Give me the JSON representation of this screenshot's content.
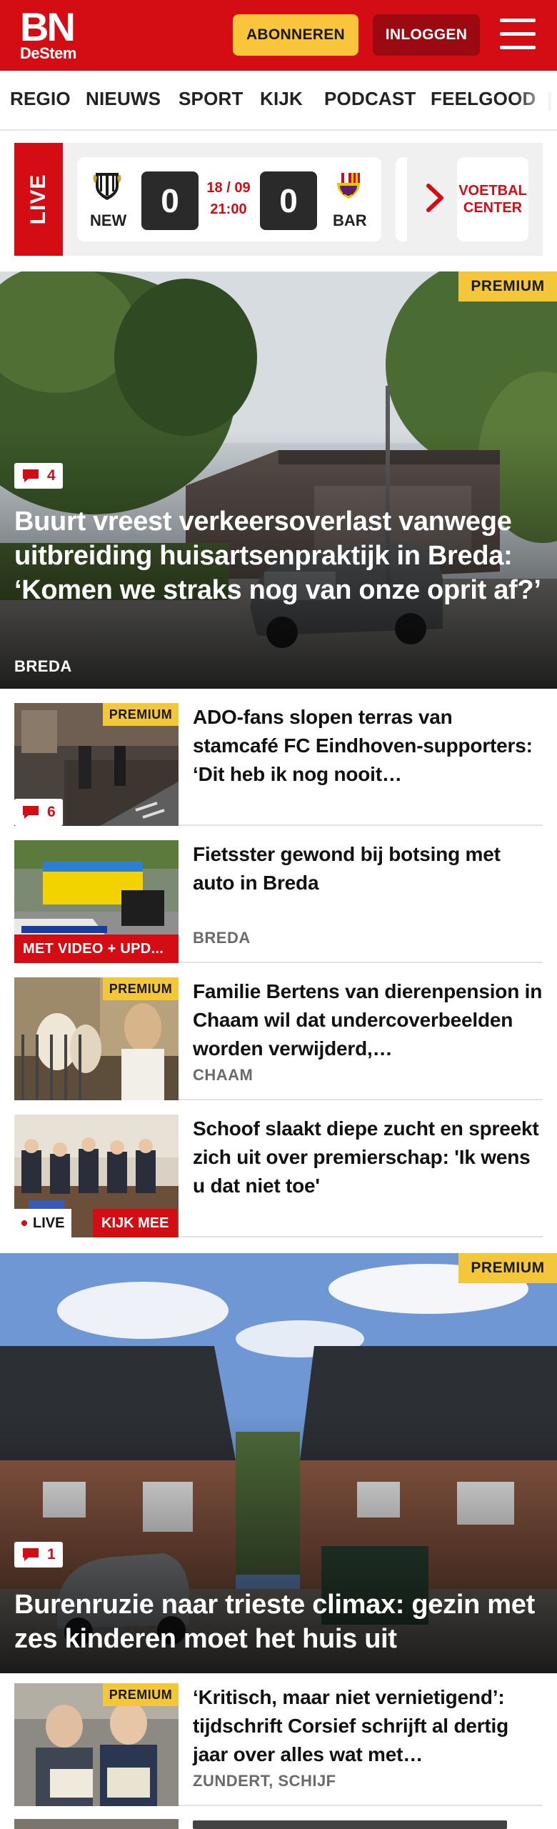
{
  "header": {
    "logo_main": "BN",
    "logo_sub": "DeStem",
    "subscribe_label": "ABONNEREN",
    "login_label": "INLOGGEN",
    "brand_color": "#d40d14"
  },
  "nav": {
    "items": [
      "REGIO",
      "NIEUWS",
      "SPORT",
      "KIJK",
      "PODCAST",
      "FEELGOOD"
    ]
  },
  "live_score": {
    "tab_label": "LIVE",
    "home_team": "NEW",
    "away_team": "BAR",
    "home_score": "0",
    "away_score": "0",
    "date": "18 / 09",
    "time": "21:00",
    "voetbal_center": "VOETBAL CENTER"
  },
  "hero1": {
    "premium": "PREMIUM",
    "comments": "4",
    "title": "Buurt vreest verkeersoverlast vanwege uitbreiding huisartsenprak­tijk in Breda: ‘Komen we straks nog van onze oprit af?’",
    "tag": "BREDA"
  },
  "articles": [
    {
      "premium": "PREMIUM",
      "comments": "6",
      "title": "ADO-fans slopen terras van stamcafé FC Eindhoven-supporters: ‘Dit heb ik nog nooit…"
    },
    {
      "badge": "MET VIDEO + UPD...",
      "title": "Fietsster gewond bij botsing met auto in Breda",
      "tag": "BREDA"
    },
    {
      "premium": "PREMIUM",
      "title": "Familie Bertens van dierenpensi­on in Chaam wil dat undercover­beelden worden verwijderd,…",
      "tag": "CHAAM"
    },
    {
      "live": "LIVE",
      "watch": "KIJK MEE",
      "title": "Schoof slaakt diepe zucht en spreekt zich uit over premier­schap: 'Ik wens u dat niet toe'"
    }
  ],
  "hero2": {
    "premium": "PREMIUM",
    "comments": "1",
    "title": "Burenruzie naar trieste climax: gezin met zes kinderen moet het huis uit"
  },
  "article5": {
    "premium": "PREMIUM",
    "title": "‘Kritisch, maar niet vernieti­gend’: tijdschrift Corsief schrijft al dertig jaar over alles wat met…",
    "tag": "ZUNDERT, SCHIJF"
  }
}
